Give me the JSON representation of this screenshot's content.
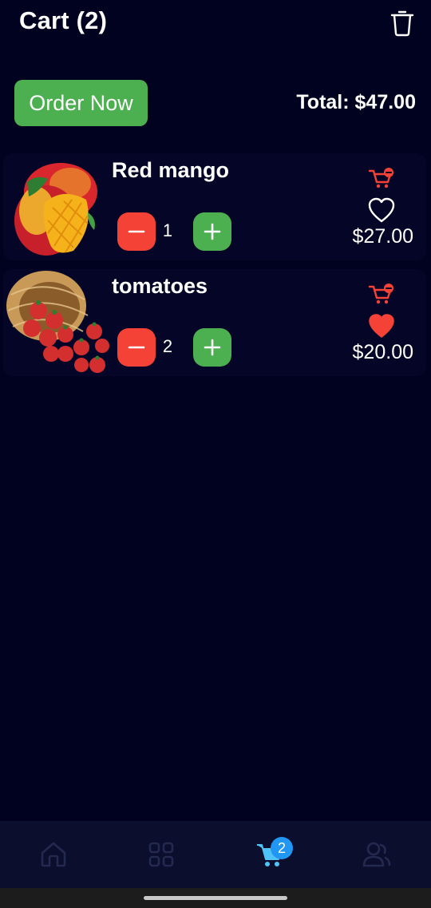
{
  "header": {
    "title": "Cart (2)",
    "trash_icon": "trash-icon"
  },
  "actions": {
    "order_label": "Order Now",
    "total_text": "Total: $47.00"
  },
  "items": [
    {
      "name": "Red mango",
      "quantity": "1",
      "price": "$27.00",
      "favorite": false,
      "image": "red-mango-image"
    },
    {
      "name": "tomatoes",
      "quantity": "2",
      "price": "$20.00",
      "favorite": true,
      "image": "tomatoes-basket-image"
    }
  ],
  "nav": {
    "items": [
      "home-icon",
      "grid-icon",
      "cart-icon",
      "profile-icon"
    ],
    "active": "cart-icon",
    "cart_badge": "2"
  },
  "colors": {
    "background": "#010220",
    "card": "#050627",
    "green": "#4caf50",
    "red": "#f44336",
    "accent_blue": "#2196f3",
    "nav_inactive": "#23294f"
  }
}
